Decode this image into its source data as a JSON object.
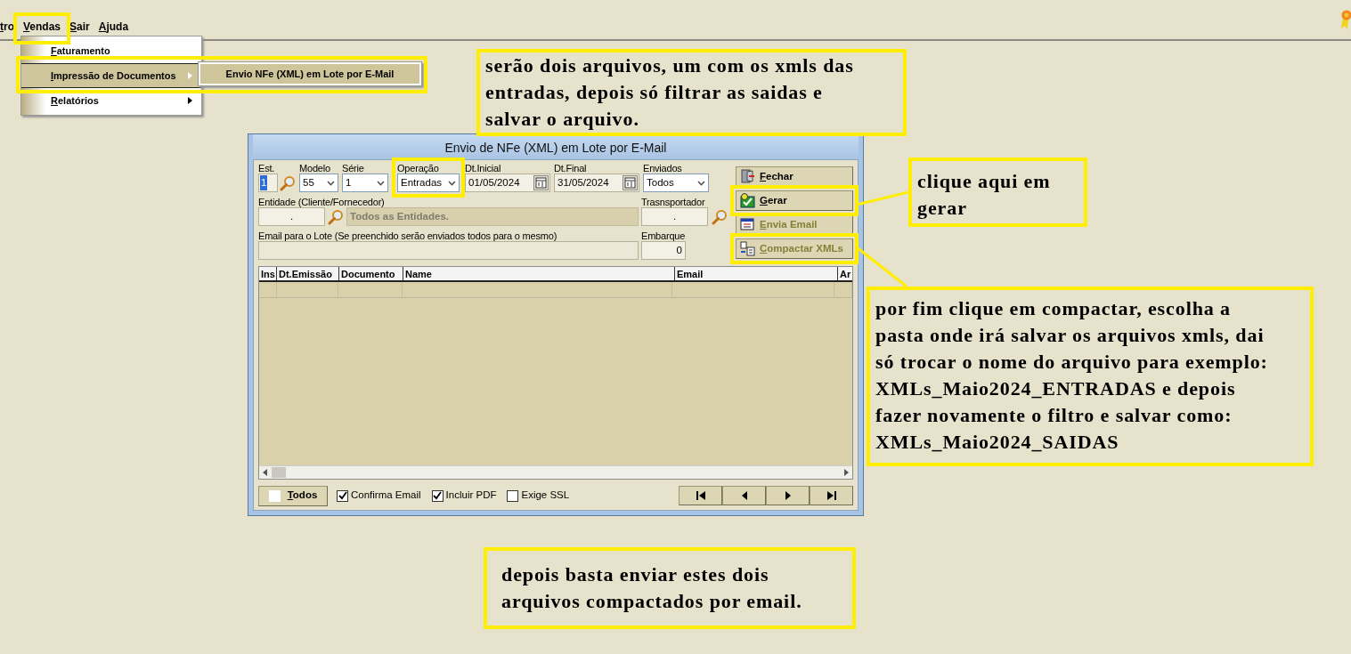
{
  "menu_bar": {
    "items": [
      {
        "label": "tro",
        "highlighted": false
      },
      {
        "label": "Vendas",
        "highlighted": true
      },
      {
        "label": "Sair",
        "highlighted": false
      },
      {
        "label": "Ajuda",
        "highlighted": false
      }
    ]
  },
  "dropdown": {
    "items": [
      {
        "label": "Faturamento",
        "selected": false,
        "has_submenu": false,
        "highlighted": false
      },
      {
        "label": "Impressão de Documentos",
        "selected": true,
        "has_submenu": true,
        "highlighted": true,
        "submenu": [
          {
            "label": "Envio NFe (XML) em Lote por E-Mail",
            "selected": true
          }
        ]
      },
      {
        "label": "Relatórios",
        "selected": false,
        "has_submenu": true,
        "highlighted": false
      }
    ]
  },
  "dialog": {
    "title": "Envio de NFe (XML) em Lote por E-Mail",
    "row1": [
      {
        "kind": "text",
        "label": "Est.",
        "value": "1",
        "text_selected": true,
        "search": true,
        "highlighted": false
      },
      {
        "kind": "select",
        "label": "Modelo",
        "value": "55",
        "search": false,
        "highlighted": false
      },
      {
        "kind": "select",
        "label": "Série",
        "value": "1",
        "search": false,
        "highlighted": false
      },
      {
        "kind": "select",
        "label": "Operação",
        "value": "Entradas",
        "search": false,
        "highlighted": true
      },
      {
        "kind": "date",
        "label": "Dt.Inicial",
        "value": "01/05/2024",
        "search": false,
        "highlighted": false
      },
      {
        "kind": "date",
        "label": "Dt.Final",
        "value": "31/05/2024",
        "search": false,
        "highlighted": false
      },
      {
        "kind": "select",
        "label": "Enviados",
        "value": "Todos",
        "search": false,
        "highlighted": false
      }
    ],
    "entity": {
      "label": "Entidade (Cliente/Fornecedor)",
      "code": ".",
      "name": "Todos as Entidades."
    },
    "carrier": {
      "label": "Trasnsportador",
      "value": "."
    },
    "email": {
      "label": "Email para o Lote (Se preenchido serão enviados todos para o mesmo)"
    },
    "shipment": {
      "label": "Embarque",
      "value": "0"
    },
    "buttons": [
      {
        "kind": "close",
        "label": "Fechar",
        "disabled": false,
        "highlighted": false
      },
      {
        "kind": "generate",
        "label": "Gerar",
        "disabled": false,
        "highlighted": true
      },
      {
        "kind": "email",
        "label": "Envia Email",
        "disabled": true,
        "highlighted": false
      },
      {
        "kind": "compress",
        "label": "Compactar XMLs",
        "disabled": true,
        "highlighted": true
      }
    ],
    "grid": {
      "columns": [
        "Ins",
        "Dt.Emissão",
        "Documento",
        "Name",
        "Email",
        "Ar"
      ]
    },
    "footer": {
      "todos": {
        "label": "Todos",
        "checked": false
      },
      "checkboxes": [
        {
          "label": "Confirma Email",
          "checked": true
        },
        {
          "label": "Incluir PDF",
          "checked": true
        },
        {
          "label": "Exige SSL",
          "checked": false
        }
      ],
      "nav": [
        {
          "kind": "first"
        },
        {
          "kind": "prev"
        },
        {
          "kind": "next"
        },
        {
          "kind": "last"
        }
      ]
    }
  },
  "annotations": [
    {
      "text": "serão dois arquivos, um com os xmls das entradas, depois só filtrar as saidas e salvar o arquivo."
    },
    {
      "text": "clique aqui em gerar"
    },
    {
      "text": "por fim clique em compactar, escolha a pasta onde irá salvar os arquivos xmls, dai só trocar o nome do arquivo para exemplo: XMLs_Maio2024_ENTRADAS e depois fazer novamente o filtro e salvar como: XMLs_Maio2024_SAIDAS"
    },
    {
      "text": "depois basta enviar estes dois arquivos compactados por email."
    }
  ]
}
